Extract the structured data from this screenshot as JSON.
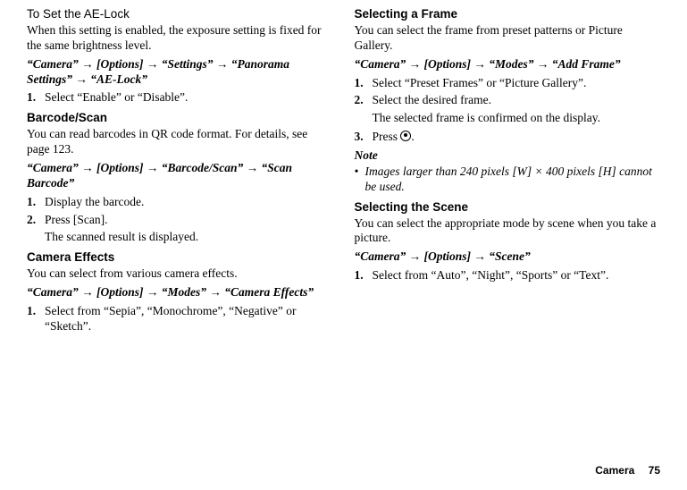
{
  "col1": {
    "aelock": {
      "heading": "To Set the AE-Lock",
      "body": "When this setting is enabled, the exposure setting is fixed for the same brightness level.",
      "path": "“Camera” → [Options]  → “Settings” → “Panorama Settings” → “AE-Lock”",
      "step1": "Select “Enable” or “Disable”."
    },
    "barcode": {
      "heading": "Barcode/Scan",
      "body": "You can read barcodes in QR code format. For details, see page 123.",
      "path": "“Camera” → [Options] → “Barcode/Scan” → “Scan Barcode”",
      "step1": "Display the barcode.",
      "step2": "Press [Scan].",
      "result": "The scanned result is displayed."
    },
    "effects": {
      "heading": "Camera Effects",
      "body": "You can select from various camera effects.",
      "path": "“Camera” → [Options] → “Modes” → “Camera Effects”",
      "step1": "Select from “Sepia”, “Monochrome”, “Negative” or “Sketch”."
    }
  },
  "col2": {
    "frame": {
      "heading": "Selecting a Frame",
      "body": "You can select the frame from preset patterns or Picture Gallery.",
      "path": "“Camera” → [Options] → “Modes” → “Add Frame”",
      "step1": "Select “Preset Frames” or “Picture Gallery”.",
      "step2": "Select the desired frame.",
      "result": "The selected frame is confirmed on the display.",
      "step3a": "Press ",
      "step3b": "."
    },
    "note": {
      "label": "Note",
      "item": "Images larger than 240 pixels [W] × 400 pixels [H] cannot be used."
    },
    "scene": {
      "heading": "Selecting the Scene",
      "body": "You can select the appropriate mode by scene when you take a picture.",
      "path": "“Camera” → [Options] → “Scene”",
      "step1": "Select from “Auto”, “Night”, “Sports” or “Text”."
    }
  },
  "footer": {
    "label": "Camera",
    "page": "75"
  }
}
